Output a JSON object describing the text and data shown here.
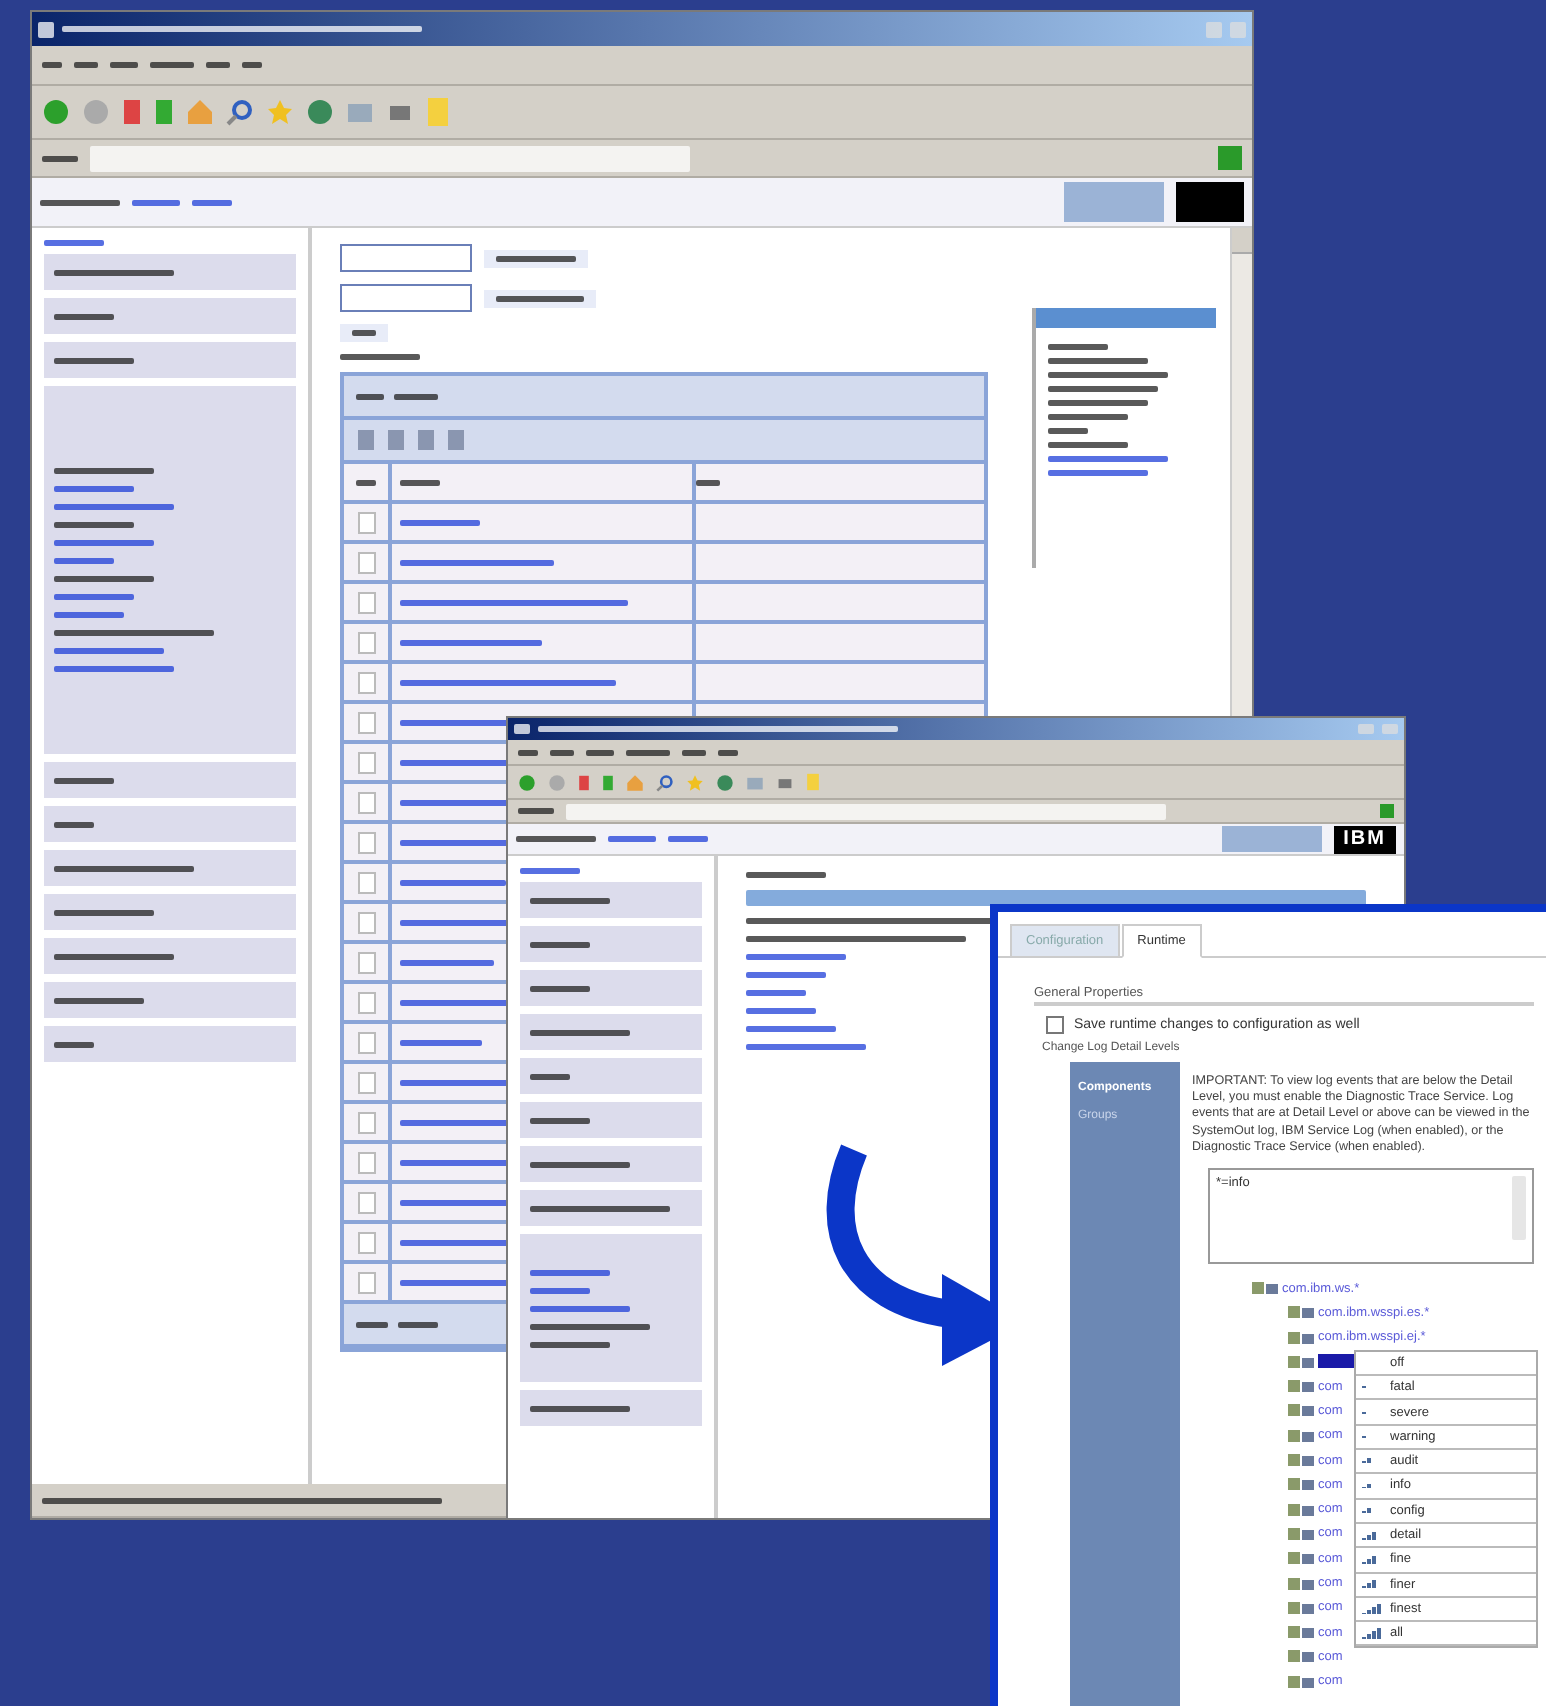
{
  "browser_window": {
    "logo": "IBM"
  },
  "table_rows": [
    {
      "checked": false
    },
    {
      "checked": false
    },
    {
      "checked": false
    },
    {
      "checked": false
    },
    {
      "checked": false
    },
    {
      "checked": false
    },
    {
      "checked": false
    },
    {
      "checked": false
    },
    {
      "checked": false
    },
    {
      "checked": false
    },
    {
      "checked": false
    },
    {
      "checked": false
    },
    {
      "checked": false
    },
    {
      "checked": false
    },
    {
      "checked": false
    },
    {
      "checked": false
    },
    {
      "checked": false
    },
    {
      "checked": false
    },
    {
      "checked": false
    },
    {
      "checked": false
    }
  ],
  "log_window": {
    "tabs": [
      {
        "label": "Configuration",
        "selected": false
      },
      {
        "label": "Runtime",
        "selected": true
      }
    ],
    "section_title": "General Properties",
    "save_option": {
      "label": "Save runtime changes to configuration as well",
      "checked": false
    },
    "subsection_title": "Change Log Detail Levels",
    "side_nav": [
      {
        "label": "Components",
        "selected": true
      },
      {
        "label": "Groups",
        "selected": false
      }
    ],
    "notice": "IMPORTANT: To view log events that are below the Detail Level, you must enable the Diagnostic Trace Service. Log events that are at Detail Level or above can be viewed in the SystemOut log, IBM Service Log (when enabled), or the Diagnostic Trace Service (when enabled).",
    "filter_text": "*=info",
    "tree": {
      "label": "com.ibm.ws.*",
      "children": [
        {
          "label": "com.ibm.wsspi.es.*",
          "selected": false
        },
        {
          "label": "com.ibm.wsspi.ej.*",
          "selected": false
        },
        {
          "selected": true
        },
        {
          "label": "com",
          "selected": false
        },
        {
          "label": "com",
          "selected": false
        },
        {
          "label": "com",
          "selected": false
        },
        {
          "label": "com",
          "selected": false
        },
        {
          "label": "com",
          "selected": false
        },
        {
          "label": "com",
          "selected": false
        },
        {
          "label": "com",
          "selected": false
        },
        {
          "label": "com",
          "selected": false
        },
        {
          "label": "com",
          "selected": false
        },
        {
          "label": "com",
          "selected": false
        },
        {
          "label": "com",
          "selected": false
        },
        {
          "label": "com",
          "selected": false
        },
        {
          "label": "com",
          "selected": false
        }
      ]
    },
    "level_menu": [
      "off",
      "fatal",
      "severe",
      "warning",
      "audit",
      "info",
      "config",
      "detail",
      "fine",
      "finer",
      "finest",
      "all"
    ]
  }
}
